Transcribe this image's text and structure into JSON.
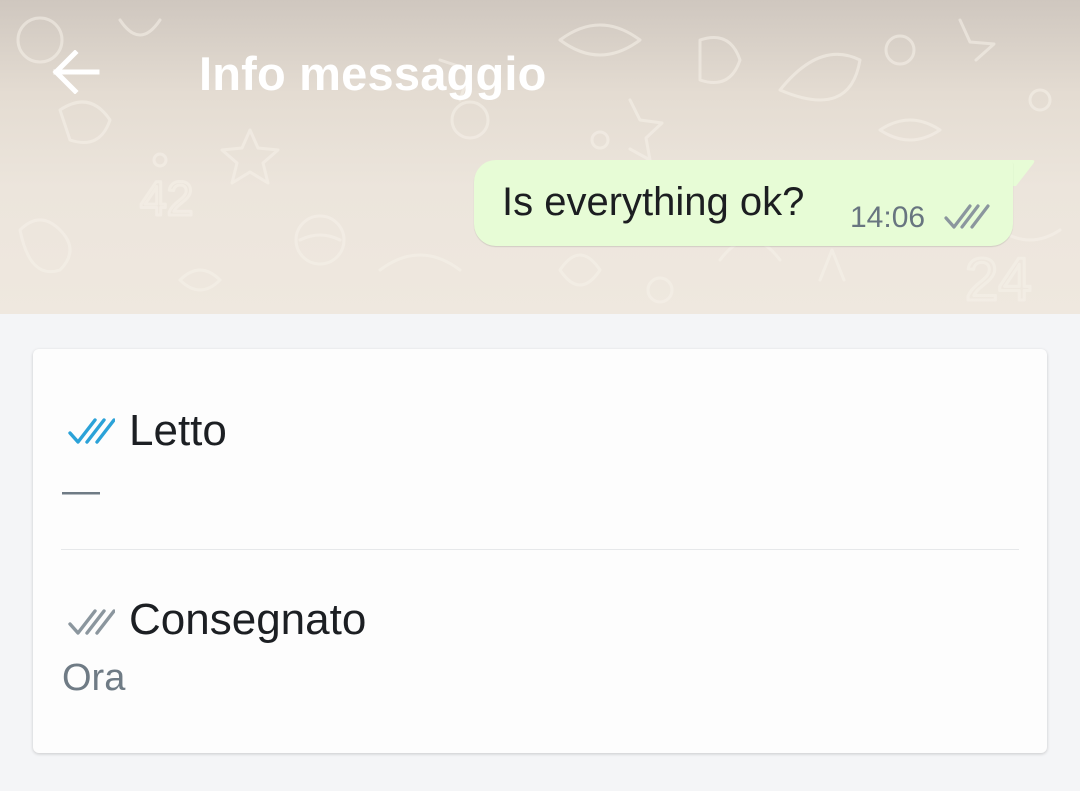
{
  "header": {
    "title": "Info messaggio",
    "back_icon": "arrow-left-icon",
    "text_color": "#ffffff"
  },
  "message": {
    "text": "Is everything ok?",
    "time": "14:06",
    "status_icon": "double-check-icon",
    "bubble_color": "#e7fcd6"
  },
  "receipts": {
    "read": {
      "label": "Letto",
      "value": "—",
      "icon": "double-check-blue-icon",
      "icon_color": "#2ba2d8"
    },
    "delivered": {
      "label": "Consegnato",
      "value": "Ora",
      "icon": "double-check-grey-icon",
      "icon_color": "#8b969e"
    }
  }
}
